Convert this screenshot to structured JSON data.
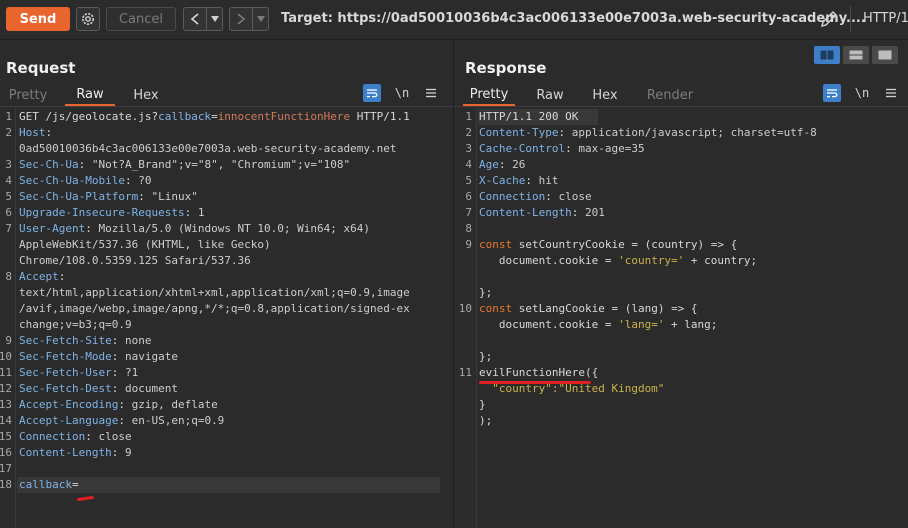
{
  "toolbar": {
    "send_label": "Send",
    "cancel_label": "Cancel",
    "back_label": "<",
    "forward_label": ">",
    "dropdown_label": "▾",
    "target_label": "Target: https://0ad50010036b4c3ac006133e00e7003a.web-security-academy....",
    "http_version": "HTTP/1"
  },
  "request": {
    "title": "Request",
    "tabs": [
      {
        "label": "Pretty",
        "state": "inactive"
      },
      {
        "label": "Raw",
        "state": "active"
      },
      {
        "label": "Hex",
        "state": "normal"
      }
    ],
    "newline_label": "\\n",
    "lines": [
      {
        "n": "1",
        "parts": [
          [
            "plain",
            "GET /js/geolocate.js?"
          ],
          [
            "param",
            "callback"
          ],
          [
            "plain",
            "="
          ],
          [
            "pval",
            "innocentFunctionHere"
          ],
          [
            "plain",
            " HTTP/1.1"
          ]
        ]
      },
      {
        "n": "2",
        "parts": [
          [
            "hk",
            "Host"
          ],
          [
            "plain",
            ":"
          ]
        ]
      },
      {
        "n": "",
        "parts": [
          [
            "hv",
            "0ad50010036b4c3ac006133e00e7003a.web-security-academy.net"
          ]
        ]
      },
      {
        "n": "3",
        "parts": [
          [
            "hk",
            "Sec-Ch-Ua"
          ],
          [
            "plain",
            ": "
          ],
          [
            "hv",
            "\"Not?A_Brand\";v=\"8\", \"Chromium\";v=\"108\""
          ]
        ]
      },
      {
        "n": "4",
        "parts": [
          [
            "hk",
            "Sec-Ch-Ua-Mobile"
          ],
          [
            "plain",
            ": "
          ],
          [
            "hv",
            "?0"
          ]
        ]
      },
      {
        "n": "5",
        "parts": [
          [
            "hk",
            "Sec-Ch-Ua-Platform"
          ],
          [
            "plain",
            ": "
          ],
          [
            "hv",
            "\"Linux\""
          ]
        ]
      },
      {
        "n": "6",
        "parts": [
          [
            "hk",
            "Upgrade-Insecure-Requests"
          ],
          [
            "plain",
            ": "
          ],
          [
            "hv",
            "1"
          ]
        ]
      },
      {
        "n": "7",
        "parts": [
          [
            "hk",
            "User-Agent"
          ],
          [
            "plain",
            ": "
          ],
          [
            "hv",
            "Mozilla/5.0 (Windows NT 10.0; Win64; x64)"
          ]
        ]
      },
      {
        "n": "",
        "parts": [
          [
            "hv",
            "AppleWebKit/537.36 (KHTML, like Gecko)"
          ]
        ]
      },
      {
        "n": "",
        "parts": [
          [
            "hv",
            "Chrome/108.0.5359.125 Safari/537.36"
          ]
        ]
      },
      {
        "n": "8",
        "parts": [
          [
            "hk",
            "Accept"
          ],
          [
            "plain",
            ":"
          ]
        ]
      },
      {
        "n": "",
        "parts": [
          [
            "hv",
            "text/html,application/xhtml+xml,application/xml;q=0.9,image"
          ]
        ]
      },
      {
        "n": "",
        "parts": [
          [
            "hv",
            "/avif,image/webp,image/apng,*/*;q=0.8,application/signed-ex"
          ]
        ]
      },
      {
        "n": "",
        "parts": [
          [
            "hv",
            "change;v=b3;q=0.9"
          ]
        ]
      },
      {
        "n": "9",
        "parts": [
          [
            "hk",
            "Sec-Fetch-Site"
          ],
          [
            "plain",
            ": "
          ],
          [
            "hv",
            "none"
          ]
        ]
      },
      {
        "n": "10",
        "parts": [
          [
            "hk",
            "Sec-Fetch-Mode"
          ],
          [
            "plain",
            ": "
          ],
          [
            "hv",
            "navigate"
          ]
        ]
      },
      {
        "n": "11",
        "parts": [
          [
            "hk",
            "Sec-Fetch-User"
          ],
          [
            "plain",
            ": "
          ],
          [
            "hv",
            "?1"
          ]
        ]
      },
      {
        "n": "12",
        "parts": [
          [
            "hk",
            "Sec-Fetch-Dest"
          ],
          [
            "plain",
            ": "
          ],
          [
            "hv",
            "document"
          ]
        ]
      },
      {
        "n": "13",
        "parts": [
          [
            "hk",
            "Accept-Encoding"
          ],
          [
            "plain",
            ": "
          ],
          [
            "hv",
            "gzip, deflate"
          ]
        ]
      },
      {
        "n": "14",
        "parts": [
          [
            "hk",
            "Accept-Language"
          ],
          [
            "plain",
            ": "
          ],
          [
            "hv",
            "en-US,en;q=0.9"
          ]
        ]
      },
      {
        "n": "15",
        "parts": [
          [
            "hk",
            "Connection"
          ],
          [
            "plain",
            ": "
          ],
          [
            "hv",
            "close"
          ]
        ]
      },
      {
        "n": "16",
        "parts": [
          [
            "hk",
            "Content-Length"
          ],
          [
            "plain",
            ": "
          ],
          [
            "hv",
            "9"
          ]
        ]
      },
      {
        "n": "17",
        "parts": []
      },
      {
        "n": "18",
        "parts": [
          [
            "param",
            "callback"
          ],
          [
            "plain",
            "="
          ]
        ]
      }
    ]
  },
  "response": {
    "title": "Response",
    "tabs": [
      {
        "label": "Pretty",
        "state": "active"
      },
      {
        "label": "Raw",
        "state": "normal"
      },
      {
        "label": "Hex",
        "state": "normal"
      },
      {
        "label": "Render",
        "state": "inactive"
      }
    ],
    "newline_label": "\\n",
    "lines": [
      {
        "n": "1",
        "parts": [
          [
            "plain",
            "HTTP/1.1 200 OK"
          ]
        ]
      },
      {
        "n": "2",
        "parts": [
          [
            "hk",
            "Content-Type"
          ],
          [
            "plain",
            ": "
          ],
          [
            "hv",
            "application/javascript; charset=utf-8"
          ]
        ]
      },
      {
        "n": "3",
        "parts": [
          [
            "hk",
            "Cache-Control"
          ],
          [
            "plain",
            ": "
          ],
          [
            "hv",
            "max-age=35"
          ]
        ]
      },
      {
        "n": "4",
        "parts": [
          [
            "hk",
            "Age"
          ],
          [
            "plain",
            ": "
          ],
          [
            "hv",
            "26"
          ]
        ]
      },
      {
        "n": "5",
        "parts": [
          [
            "hk",
            "X-Cache"
          ],
          [
            "plain",
            ": "
          ],
          [
            "hv",
            "hit"
          ]
        ]
      },
      {
        "n": "6",
        "parts": [
          [
            "hk",
            "Connection"
          ],
          [
            "plain",
            ": "
          ],
          [
            "hv",
            "close"
          ]
        ]
      },
      {
        "n": "7",
        "parts": [
          [
            "hk",
            "Content-Length"
          ],
          [
            "plain",
            ": "
          ],
          [
            "hv",
            "201"
          ]
        ]
      },
      {
        "n": "8",
        "parts": []
      },
      {
        "n": "9",
        "parts": [
          [
            "kw",
            "const"
          ],
          [
            "plain",
            " setCountryCookie = (country) => {"
          ]
        ]
      },
      {
        "n": "",
        "parts": [
          [
            "plain",
            "   document.cookie = "
          ],
          [
            "str",
            "'country='"
          ],
          [
            "plain",
            " + country;"
          ]
        ]
      },
      {
        "n": "",
        "parts": []
      },
      {
        "n": "",
        "parts": [
          [
            "plain",
            "};"
          ]
        ]
      },
      {
        "n": "10",
        "parts": [
          [
            "kw",
            "const"
          ],
          [
            "plain",
            " setLangCookie = (lang) => {"
          ]
        ]
      },
      {
        "n": "",
        "parts": [
          [
            "plain",
            "   document.cookie = "
          ],
          [
            "str",
            "'lang='"
          ],
          [
            "plain",
            " + lang;"
          ]
        ]
      },
      {
        "n": "",
        "parts": []
      },
      {
        "n": "",
        "parts": [
          [
            "plain",
            "};"
          ]
        ]
      },
      {
        "n": "11",
        "parts": [
          [
            "plain",
            "evilFunctionHere({"
          ]
        ]
      },
      {
        "n": "",
        "parts": [
          [
            "str",
            "  \"country\":\"United Kingdom\""
          ]
        ]
      },
      {
        "n": "",
        "parts": [
          [
            "plain",
            "}"
          ]
        ]
      },
      {
        "n": "",
        "parts": [
          [
            "plain",
            ");"
          ]
        ]
      }
    ]
  },
  "colors": {
    "accent": "#e8662d",
    "selected_blue": "#3d7fc8",
    "annotation_red": "#e02020"
  }
}
